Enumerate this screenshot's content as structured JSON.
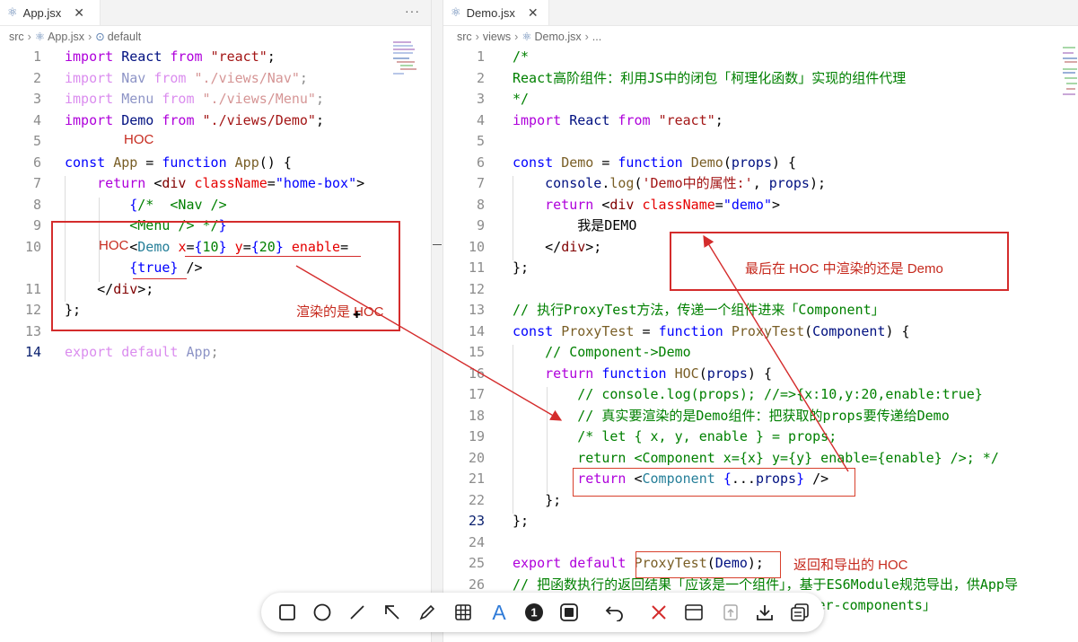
{
  "left_pane": {
    "tab": {
      "icon": "react-atom-icon",
      "label": "App.jsx",
      "close": "✕"
    },
    "more": "···",
    "breadcrumb": [
      "src",
      "App.jsx",
      "default"
    ],
    "lines": [
      {
        "n": "1",
        "tokens": [
          [
            "kw",
            "import"
          ],
          [
            "pl",
            " "
          ],
          [
            "vr",
            "React"
          ],
          [
            "pl",
            " "
          ],
          [
            "kw",
            "from"
          ],
          [
            "pl",
            " "
          ],
          [
            "st",
            "\"react\""
          ],
          [
            "pl",
            ";"
          ]
        ]
      },
      {
        "n": "2",
        "faded": true,
        "tokens": [
          [
            "kw",
            "import"
          ],
          [
            "pl",
            " "
          ],
          [
            "vr",
            "Nav"
          ],
          [
            "pl",
            " "
          ],
          [
            "kw",
            "from"
          ],
          [
            "pl",
            " "
          ],
          [
            "st",
            "\"./views/Nav\""
          ],
          [
            "pl",
            ";"
          ]
        ]
      },
      {
        "n": "3",
        "faded": true,
        "tokens": [
          [
            "kw",
            "import"
          ],
          [
            "pl",
            " "
          ],
          [
            "vr",
            "Menu"
          ],
          [
            "pl",
            " "
          ],
          [
            "kw",
            "from"
          ],
          [
            "pl",
            " "
          ],
          [
            "st",
            "\"./views/Menu\""
          ],
          [
            "pl",
            ";"
          ]
        ]
      },
      {
        "n": "4",
        "tokens": [
          [
            "kw",
            "import"
          ],
          [
            "pl",
            " "
          ],
          [
            "vr",
            "Demo"
          ],
          [
            "pl",
            " "
          ],
          [
            "kw",
            "from"
          ],
          [
            "pl",
            " "
          ],
          [
            "st",
            "\"./views/Demo\""
          ],
          [
            "pl",
            ";"
          ]
        ]
      },
      {
        "n": "5",
        "tokens": []
      },
      {
        "n": "6",
        "tokens": [
          [
            "kw2",
            "const"
          ],
          [
            "pl",
            " "
          ],
          [
            "id",
            "App"
          ],
          [
            "pl",
            " = "
          ],
          [
            "kw2",
            "function"
          ],
          [
            "pl",
            " "
          ],
          [
            "id",
            "App"
          ],
          [
            "pl",
            "() {"
          ]
        ]
      },
      {
        "n": "7",
        "tokens": [
          [
            "pl",
            "    "
          ],
          [
            "kw",
            "return"
          ],
          [
            "pl",
            " <"
          ],
          [
            "tg",
            "div"
          ],
          [
            "pl",
            " "
          ],
          [
            "at",
            "className"
          ],
          [
            "pl",
            "="
          ],
          [
            "kw2",
            "\"home-box\""
          ],
          [
            "pl",
            ">"
          ]
        ]
      },
      {
        "n": "8",
        "tokens": [
          [
            "pl",
            "        "
          ],
          [
            "kw2",
            "{"
          ],
          [
            "cm",
            "/*  <Nav />"
          ]
        ]
      },
      {
        "n": "9",
        "tokens": [
          [
            "cm",
            "        <Menu /> */"
          ],
          [
            "kw2",
            "}"
          ]
        ]
      },
      {
        "n": "10",
        "tokens": [
          [
            "pl",
            "        <"
          ],
          [
            "ty",
            "Demo"
          ],
          [
            "pl",
            " "
          ],
          [
            "at",
            "x"
          ],
          [
            "pl",
            "="
          ],
          [
            "kw2",
            "{"
          ],
          [
            "cm",
            "10"
          ],
          [
            "kw2",
            "}"
          ],
          [
            "pl",
            " "
          ],
          [
            "at",
            "y"
          ],
          [
            "pl",
            "="
          ],
          [
            "kw2",
            "{"
          ],
          [
            "cm",
            "20"
          ],
          [
            "kw2",
            "}"
          ],
          [
            "pl",
            " "
          ],
          [
            "at",
            "enable"
          ],
          [
            "pl",
            "="
          ]
        ]
      },
      {
        "n": "",
        "tokens": [
          [
            "pl",
            "        "
          ],
          [
            "kw2",
            "{"
          ],
          [
            "kw2",
            "true"
          ],
          [
            "kw2",
            "}"
          ],
          [
            "pl",
            " />"
          ]
        ]
      },
      {
        "n": "11",
        "tokens": [
          [
            "pl",
            "    </"
          ],
          [
            "tg",
            "div"
          ],
          [
            "pl",
            ">;"
          ]
        ]
      },
      {
        "n": "12",
        "tokens": [
          [
            "pl",
            "};"
          ]
        ]
      },
      {
        "n": "13",
        "tokens": []
      },
      {
        "n": "14",
        "active": true,
        "faded": true,
        "tokens": [
          [
            "kw",
            "export"
          ],
          [
            "pl",
            " "
          ],
          [
            "kw",
            "default"
          ],
          [
            "pl",
            " "
          ],
          [
            "vr",
            "App"
          ],
          [
            "pl",
            ";"
          ]
        ]
      }
    ],
    "annotations": {
      "hoc_top": "HOC",
      "hoc_left": "HOC",
      "render_note": "渲染的是 HOC"
    }
  },
  "right_pane": {
    "tab": {
      "icon": "react-atom-icon",
      "label": "Demo.jsx",
      "close": "✕"
    },
    "breadcrumb": [
      "src",
      "views",
      "Demo.jsx",
      "..."
    ],
    "lines": [
      {
        "n": "1",
        "tokens": [
          [
            "cm",
            "/*"
          ]
        ]
      },
      {
        "n": "2",
        "tokens": [
          [
            "cm",
            "React高阶组件：利用JS中的闭包「柯理化函数」实现的组件代理"
          ]
        ]
      },
      {
        "n": "3",
        "tokens": [
          [
            "cm",
            "*/"
          ]
        ]
      },
      {
        "n": "4",
        "tokens": [
          [
            "kw",
            "import"
          ],
          [
            "pl",
            " "
          ],
          [
            "vr",
            "React"
          ],
          [
            "pl",
            " "
          ],
          [
            "kw",
            "from"
          ],
          [
            "pl",
            " "
          ],
          [
            "st",
            "\"react\""
          ],
          [
            "pl",
            ";"
          ]
        ]
      },
      {
        "n": "5",
        "tokens": []
      },
      {
        "n": "6",
        "tokens": [
          [
            "kw2",
            "const"
          ],
          [
            "pl",
            " "
          ],
          [
            "id",
            "Demo"
          ],
          [
            "pl",
            " = "
          ],
          [
            "kw2",
            "function"
          ],
          [
            "pl",
            " "
          ],
          [
            "id",
            "Demo"
          ],
          [
            "pl",
            "("
          ],
          [
            "vr",
            "props"
          ],
          [
            "pl",
            ") {"
          ]
        ]
      },
      {
        "n": "7",
        "tokens": [
          [
            "pl",
            "    "
          ],
          [
            "vr",
            "console"
          ],
          [
            "pl",
            "."
          ],
          [
            "id",
            "log"
          ],
          [
            "pl",
            "("
          ],
          [
            "st",
            "'Demo中的属性:'"
          ],
          [
            "pl",
            ", "
          ],
          [
            "vr",
            "props"
          ],
          [
            "pl",
            ");"
          ]
        ]
      },
      {
        "n": "8",
        "tokens": [
          [
            "pl",
            "    "
          ],
          [
            "kw",
            "return"
          ],
          [
            "pl",
            " <"
          ],
          [
            "tg",
            "div"
          ],
          [
            "pl",
            " "
          ],
          [
            "at",
            "className"
          ],
          [
            "pl",
            "="
          ],
          [
            "kw2",
            "\"demo\""
          ],
          [
            "pl",
            ">"
          ]
        ]
      },
      {
        "n": "9",
        "tokens": [
          [
            "pl",
            "        我是DEMO"
          ]
        ]
      },
      {
        "n": "10",
        "tokens": [
          [
            "pl",
            "    </"
          ],
          [
            "tg",
            "div"
          ],
          [
            "pl",
            ">;"
          ]
        ]
      },
      {
        "n": "11",
        "tokens": [
          [
            "pl",
            "};"
          ]
        ]
      },
      {
        "n": "12",
        "tokens": []
      },
      {
        "n": "13",
        "tokens": [
          [
            "cm",
            "// 执行ProxyTest方法，传递一个组件进来「Component」"
          ]
        ]
      },
      {
        "n": "14",
        "tokens": [
          [
            "kw2",
            "const"
          ],
          [
            "pl",
            " "
          ],
          [
            "id",
            "ProxyTest"
          ],
          [
            "pl",
            " = "
          ],
          [
            "kw2",
            "function"
          ],
          [
            "pl",
            " "
          ],
          [
            "id",
            "ProxyTest"
          ],
          [
            "pl",
            "("
          ],
          [
            "vr",
            "Component"
          ],
          [
            "pl",
            ") {"
          ]
        ]
      },
      {
        "n": "15",
        "tokens": [
          [
            "pl",
            "    "
          ],
          [
            "cm",
            "// Component->Demo"
          ]
        ]
      },
      {
        "n": "16",
        "tokens": [
          [
            "pl",
            "    "
          ],
          [
            "kw",
            "return"
          ],
          [
            "pl",
            " "
          ],
          [
            "kw2",
            "function"
          ],
          [
            "pl",
            " "
          ],
          [
            "id",
            "HOC"
          ],
          [
            "pl",
            "("
          ],
          [
            "vr",
            "props"
          ],
          [
            "pl",
            ") {"
          ]
        ]
      },
      {
        "n": "17",
        "tokens": [
          [
            "pl",
            "        "
          ],
          [
            "cm",
            "// console.log(props); //=>{x:10,y:20,enable:true}"
          ]
        ]
      },
      {
        "n": "18",
        "tokens": [
          [
            "pl",
            "        "
          ],
          [
            "cm",
            "// 真实要渲染的是Demo组件：把获取的props要传递给Demo"
          ]
        ]
      },
      {
        "n": "19",
        "tokens": [
          [
            "pl",
            "        "
          ],
          [
            "cm",
            "/* let { x, y, enable } = props;"
          ]
        ]
      },
      {
        "n": "20",
        "tokens": [
          [
            "cm",
            "        return <Component x={x} y={y} enable={enable} />; */"
          ]
        ]
      },
      {
        "n": "21",
        "tokens": [
          [
            "pl",
            "        "
          ],
          [
            "kw",
            "return"
          ],
          [
            "pl",
            " <"
          ],
          [
            "ty",
            "Component"
          ],
          [
            "pl",
            " "
          ],
          [
            "kw2",
            "{"
          ],
          [
            "pl",
            "..."
          ],
          [
            "vr",
            "props"
          ],
          [
            "kw2",
            "}"
          ],
          [
            "pl",
            " />"
          ]
        ]
      },
      {
        "n": "22",
        "tokens": [
          [
            "pl",
            "    };"
          ]
        ]
      },
      {
        "n": "23",
        "active": true,
        "tokens": [
          [
            "pl",
            "};"
          ]
        ]
      },
      {
        "n": "24",
        "tokens": []
      },
      {
        "n": "25",
        "tokens": [
          [
            "kw",
            "export"
          ],
          [
            "pl",
            " "
          ],
          [
            "kw",
            "default"
          ],
          [
            "pl",
            " "
          ],
          [
            "id",
            "ProxyTest"
          ],
          [
            "pl",
            "("
          ],
          [
            "vr",
            "Demo"
          ],
          [
            "pl",
            ");"
          ]
        ]
      },
      {
        "n": "26",
        "tokens": [
          [
            "cm",
            "// 把函数执行的返回结果「应该是一个组件」，基于ES6Module规范导出，供App导"
          ]
        ]
      },
      {
        "n": "27",
        "tokens": [
          [
            "cm",
            "// 当前案例中，我们导出的是HOC「higher-order-components」"
          ]
        ]
      }
    ],
    "annotations": {
      "render_demo_note": "最后在 HOC 中渲染的还是 Demo",
      "export_note": "返回和导出的 HOC"
    }
  },
  "toolbar": {
    "tools": [
      {
        "name": "rectangle-tool-icon"
      },
      {
        "name": "ellipse-tool-icon"
      },
      {
        "name": "line-tool-icon"
      },
      {
        "name": "arrow-tool-icon"
      },
      {
        "name": "pencil-tool-icon"
      },
      {
        "name": "mosaic-tool-icon"
      },
      {
        "name": "text-tool-icon",
        "label": "A"
      },
      {
        "name": "number-marker-tool-icon",
        "label": "1"
      },
      {
        "name": "highlight-tool-icon"
      },
      {
        "name": "undo-icon"
      },
      {
        "name": "cancel-icon"
      },
      {
        "name": "window-capture-icon"
      },
      {
        "name": "pin-icon"
      },
      {
        "name": "download-icon"
      },
      {
        "name": "copy-icon"
      }
    ]
  },
  "colors": {
    "annotation_red": "#d42c2c",
    "text_tool_blue": "#2f7bd8"
  }
}
